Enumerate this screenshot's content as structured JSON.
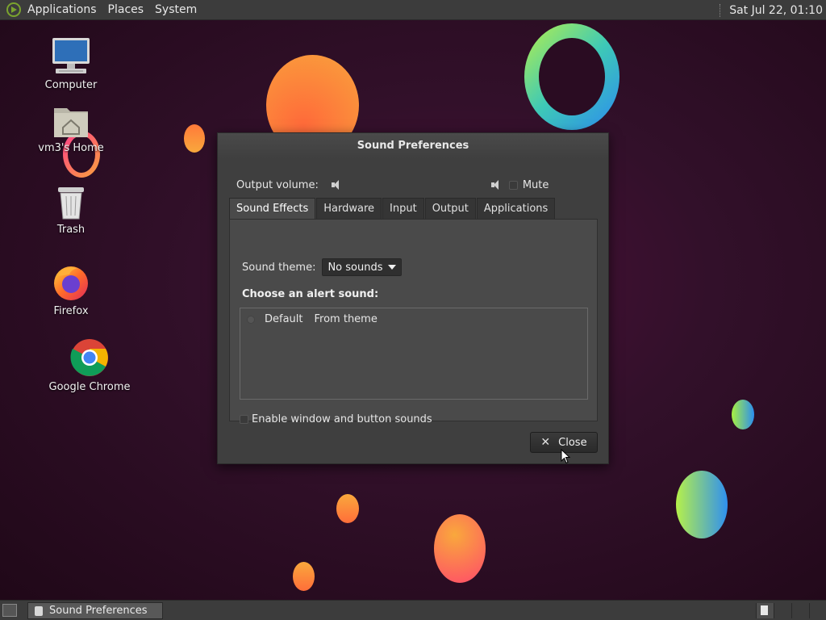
{
  "top_panel": {
    "menus": [
      "Applications",
      "Places",
      "System"
    ],
    "clock": "Sat Jul 22, 01:10"
  },
  "desktop": {
    "icons": [
      {
        "label": "Computer",
        "icon": "computer-icon"
      },
      {
        "label": "vm3's Home",
        "icon": "home-folder-icon"
      },
      {
        "label": "Trash",
        "icon": "trash-icon"
      },
      {
        "label": "Firefox",
        "icon": "firefox-icon"
      },
      {
        "label": "Google Chrome",
        "icon": "chrome-icon"
      }
    ]
  },
  "dialog": {
    "title": "Sound Preferences",
    "output_volume_label": "Output volume:",
    "mute_label": "Mute",
    "tabs": [
      "Sound Effects",
      "Hardware",
      "Input",
      "Output",
      "Applications"
    ],
    "active_tab": "Sound Effects",
    "sound_theme_label": "Sound theme:",
    "sound_theme_value": "No sounds",
    "alert_heading": "Choose an alert sound:",
    "alert_items": [
      {
        "name": "Default",
        "type": "From theme"
      }
    ],
    "enable_sounds_label": "Enable window and button sounds",
    "close_label": "Close"
  },
  "taskbar": {
    "tasks": [
      {
        "label": "Sound Preferences"
      }
    ]
  }
}
